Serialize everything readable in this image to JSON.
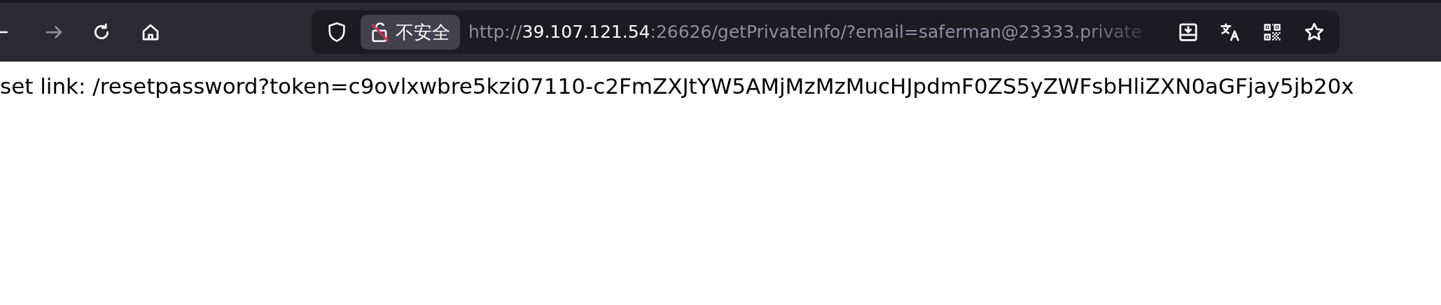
{
  "toolbar": {
    "forward": {
      "disabled": true
    },
    "address_bar": {
      "security_label": "不安全",
      "url_scheme": "http://",
      "url_host": "39.107.121.54",
      "url_rest": ":26626/getPrivateInfo/?email=saferman@23333.private"
    }
  },
  "page": {
    "text": "set link: /resetpassword?token=c9ovlxwbre5kzi07110-c2FmZXJtYW5AMjMzMzMucHJpdmF0ZS5yZWFsbHliZXN0aGFjay5jb20x"
  }
}
